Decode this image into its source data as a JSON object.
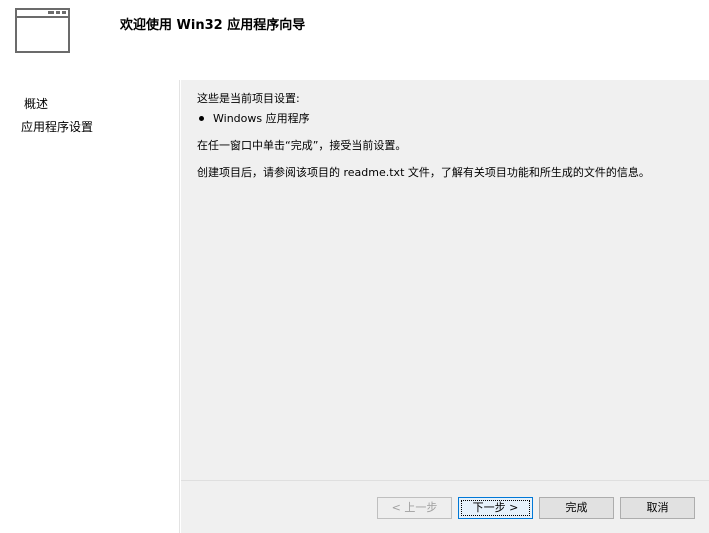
{
  "header": {
    "title": "欢迎使用 Win32 应用程序向导",
    "icon": "window-icon"
  },
  "nav": {
    "items": [
      {
        "label": "概述"
      },
      {
        "label": "应用程序设置"
      }
    ]
  },
  "content": {
    "settings_heading": "这些是当前项目设置:",
    "bullet_item": "Windows 应用程序",
    "finish_hint": "在任一窗口中单击“完成”，接受当前设置。",
    "readme_hint": "创建项目后，请参阅该项目的 readme.txt 文件，了解有关项目功能和所生成的文件的信息。"
  },
  "buttons": {
    "prev": "< 上一步",
    "next": "下一步 >",
    "finish": "完成",
    "cancel": "取消"
  },
  "colors": {
    "content_bg": "#f0f0f0",
    "primary_border": "#0078d7"
  }
}
